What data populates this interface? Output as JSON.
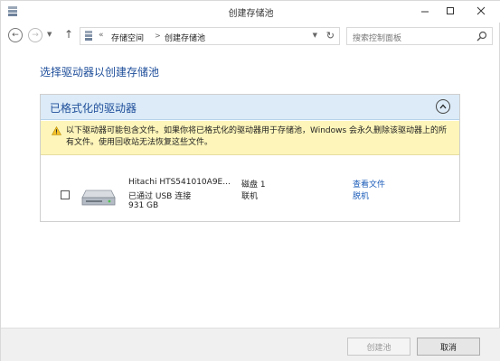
{
  "window": {
    "title": "创建存储池"
  },
  "addressbar": {
    "separator": "«",
    "crumbs": [
      "存储空间",
      "创建存储池"
    ],
    "search_placeholder": "搜索控制面板"
  },
  "main": {
    "heading": "选择驱动器以创建存储池",
    "group": {
      "title": "已格式化的驱动器",
      "warning": "以下驱动器可能包含文件。如果你将已格式化的驱动器用于存储池，Windows 会永久删除该驱动器上的所有文件。使用回收站无法恢复这些文件。",
      "drives": [
        {
          "name": "Hitachi HTS541010A9E...",
          "connection": "已通过 USB 连接",
          "size": "931 GB",
          "disk": "磁盘 1",
          "state": "联机",
          "link_view": "查看文件",
          "link_offline": "脱机",
          "checked": false
        }
      ]
    }
  },
  "footer": {
    "create_label": "创建池",
    "cancel_label": "取消"
  },
  "colors": {
    "accent": "#1e4e9a",
    "header_bg": "#dcebf7",
    "warning_bg": "#fdf5b9",
    "link": "#1a5bb8"
  }
}
